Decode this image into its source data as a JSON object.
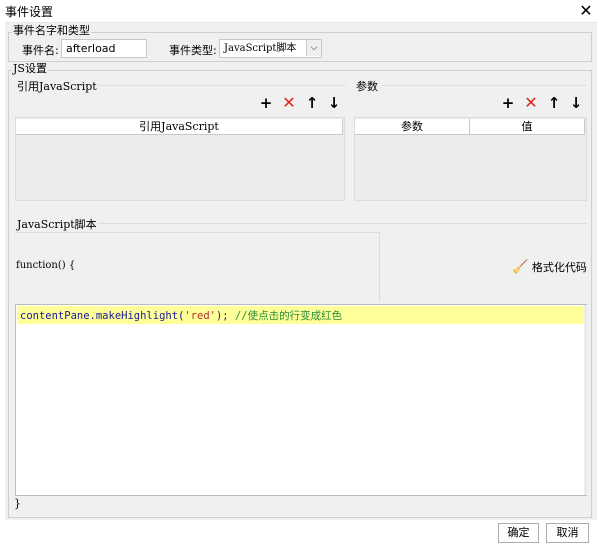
{
  "window": {
    "title": "事件设置"
  },
  "event_group": {
    "legend": "事件名字和类型",
    "name_label": "事件名:",
    "name_value": "afterload",
    "type_label": "事件类型:",
    "type_value": "JavaScript脚本"
  },
  "js_group": {
    "legend": "JS设置",
    "ref_legend": "引用JavaScript",
    "ref_column": "引用JavaScript",
    "param_legend": "参数",
    "param_columns": [
      "参数",
      "值"
    ]
  },
  "script_section": {
    "legend": "JavaScript脚本",
    "function_header": "function() {",
    "format_label": "格式化代码",
    "code": {
      "object": "contentPane.makeHighlight(",
      "string": "'red'",
      "close": "); ",
      "comment": "//使点击的行变成红色"
    },
    "closing_brace": "}"
  },
  "footer": {
    "ok_label": "确定",
    "cancel_label": "取消"
  },
  "colors": {
    "string": "#b02a37",
    "comment": "#2a8b3a",
    "keyword": "#1a1a99",
    "highlight": "#ffff99"
  }
}
